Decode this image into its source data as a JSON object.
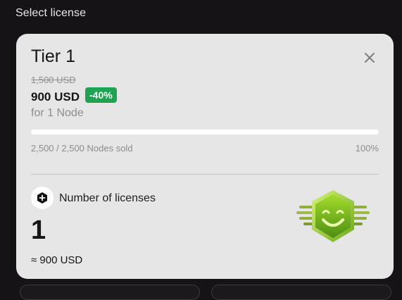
{
  "header": {
    "title": "Select license"
  },
  "tier": {
    "title": "Tier 1",
    "old_price": "1,500 USD",
    "price": "900 USD",
    "discount": "-40%",
    "unit": "for 1 Node",
    "progress": {
      "sold_text": "2,500 / 2,500 Nodes sold",
      "percent_text": "100%",
      "fraction": 1.0
    }
  },
  "licenses": {
    "label": "Number of licenses",
    "quantity": "1",
    "approx_total": "≈ 900 USD"
  },
  "icons": {
    "close": "close-icon",
    "add": "plus-hexagon-icon",
    "badge": "smiley-hexagon-badge-icon"
  },
  "colors": {
    "discount_badge": "#1ea352",
    "badge_green": "#7cc11f"
  }
}
